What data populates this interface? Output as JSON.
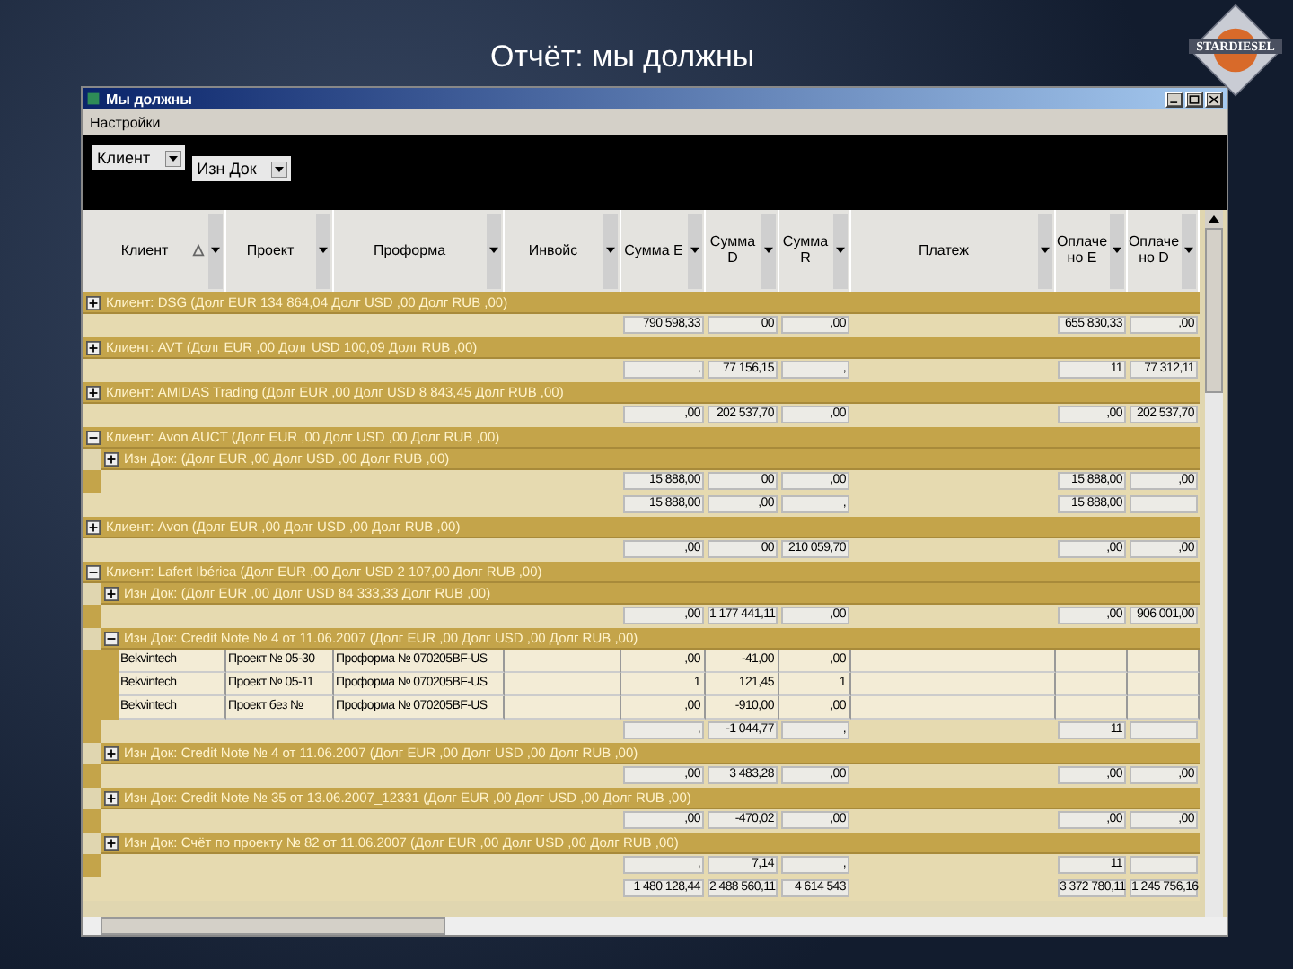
{
  "slide": {
    "title": "Отчёт: мы должны",
    "logo": "STARDIESEL"
  },
  "window": {
    "title": "Мы должны"
  },
  "menu": [
    "Настройки"
  ],
  "group_by": [
    "Клиент",
    "Изн Док"
  ],
  "columns": [
    {
      "label": "Клиент",
      "sorted": true
    },
    {
      "label": "Проект",
      "sorted": false
    },
    {
      "label": "Проформа",
      "sorted": false
    },
    {
      "label": "Инвойс",
      "sorted": false
    },
    {
      "label": "Сумма E",
      "sorted": false
    },
    {
      "label": "Сумма D",
      "sorted": false
    },
    {
      "label": "Сумма R",
      "sorted": false
    },
    {
      "label": "Платеж",
      "sorted": false
    },
    {
      "label": "Оплачено E",
      "sorted": false
    },
    {
      "label": "Оплачено D",
      "sorted": false
    }
  ],
  "rows": [
    {
      "kind": "group",
      "label": "Клиент: DSG (Долг EUR 134 864,04 Долг USD ,00 Долг RUB ,00)",
      "expanded": false
    },
    {
      "kind": "totals",
      "sum_e": "790 598,33",
      "sum_d": "00",
      "sum_r": ",00",
      "paid_e": "655 830,33",
      "paid_d": ",00"
    },
    {
      "kind": "group",
      "label": "Клиент: AVT (Долг EUR ,00 Долг USD 100,09 Долг RUB ,00)",
      "expanded": false
    },
    {
      "kind": "totals",
      "sum_e": ",",
      "sum_d": "77 156,15",
      "sum_r": ",",
      "paid_e": "11",
      "paid_d": "77 312,11"
    },
    {
      "kind": "group",
      "label": "Клиент: AMIDAS Trading (Долг EUR ,00 Долг USD 8 843,45 Долг RUB ,00)",
      "expanded": false
    },
    {
      "kind": "totals",
      "sum_e": ",00",
      "sum_d": "202 537,70",
      "sum_r": ",00",
      "paid_e": ",00",
      "paid_d": "202 537,70"
    },
    {
      "kind": "group",
      "label": "Клиент: Avon AUCT (Долг EUR ,00 Долг USD ,00 Долг RUB ,00)",
      "expanded": true,
      "children": [
        {
          "kind": "group",
          "label": "Изн Док: (Долг EUR ,00 Долг USD ,00 Долг RUB ,00)",
          "expanded": false
        },
        {
          "kind": "totals",
          "sum_e": "15 888,00",
          "sum_d": "00",
          "sum_r": ",00",
          "paid_e": "15 888,00",
          "paid_d": ",00"
        }
      ]
    },
    {
      "kind": "totals",
      "sum_e": "15 888,00",
      "sum_d": ",00",
      "sum_r": ",",
      "paid_e": "15 888,00"
    },
    {
      "kind": "group",
      "label": "Клиент: Avon (Долг EUR ,00 Долг USD ,00 Долг RUB ,00)",
      "expanded": false
    },
    {
      "kind": "totals",
      "sum_e": ",00",
      "sum_d": "00",
      "sum_r": "210 059,70",
      "paid_e": ",00",
      "paid_d": ",00"
    },
    {
      "kind": "group",
      "label": "Клиент: Lafert Ibérica (Долг EUR ,00 Долг USD 2 107,00 Долг RUB ,00)",
      "expanded": true,
      "children": [
        {
          "kind": "group",
          "label": "Изн Док: (Долг EUR ,00 Долг USD 84 333,33 Долг RUB ,00)",
          "expanded": false
        },
        {
          "kind": "totals",
          "sum_e": ",00",
          "sum_d": "1 177 441,11",
          "sum_r": ",00",
          "paid_e": ",00",
          "paid_d": "906 001,00"
        },
        {
          "kind": "group",
          "label": "Изн Док: Credit Note № 4 от 11.06.2007 (Долг EUR ,00 Долг USD ,00 Долг RUB ,00)",
          "expanded": true,
          "children": [
            {
              "kind": "detail",
              "cells": [
                "Bekvintech",
                "Проект № 05-30",
                "Проформа № 070205BF-US",
                ",00",
                "-41,00",
                ",00"
              ]
            },
            {
              "kind": "detail",
              "cells": [
                "Bekvintech",
                "Проект № 05-11",
                "Проформа № 070205BF-US",
                "1",
                "121,45",
                "1"
              ]
            },
            {
              "kind": "detail",
              "cells": [
                "Bekvintech",
                "Проект без №",
                "Проформа № 070205BF-US",
                ",00",
                "-910,00",
                ",00"
              ]
            }
          ]
        },
        {
          "kind": "totals",
          "sum_e": ",",
          "sum_d": "-1 044,77",
          "sum_r": ",",
          "paid_e": "11"
        },
        {
          "kind": "group",
          "label": "Изн Док: Credit Note № 4 от 11.06.2007 (Долг EUR ,00 Долг USD ,00 Долг RUB ,00)",
          "expanded": false
        },
        {
          "kind": "totals",
          "sum_e": ",00",
          "sum_d": "3 483,28",
          "sum_r": ",00",
          "paid_e": ",00",
          "paid_d": ",00"
        },
        {
          "kind": "group",
          "label": "Изн Док: Credit Note № 35 от 13.06.2007_12331 (Долг EUR ,00 Долг USD ,00 Долг RUB ,00)",
          "expanded": false
        },
        {
          "kind": "totals",
          "sum_e": ",00",
          "sum_d": "-470,02",
          "sum_r": ",00",
          "paid_e": ",00",
          "paid_d": ",00"
        },
        {
          "kind": "group",
          "label": "Изн Док: Счёт по проекту № 82 от 11.06.2007 (Долг EUR ,00 Долг USD ,00 Долг RUB ,00)",
          "expanded": false
        },
        {
          "kind": "totals",
          "sum_e": ",",
          "sum_d": "7,14",
          "sum_r": ",",
          "paid_e": "11"
        }
      ]
    },
    {
      "kind": "totals",
      "sum_e": "1 480 128,44",
      "sum_d": "2 488 560,11",
      "sum_r": "4 614 543",
      "paid_e": "3 372 780,11",
      "paid_d": "1 245 756,16"
    }
  ]
}
